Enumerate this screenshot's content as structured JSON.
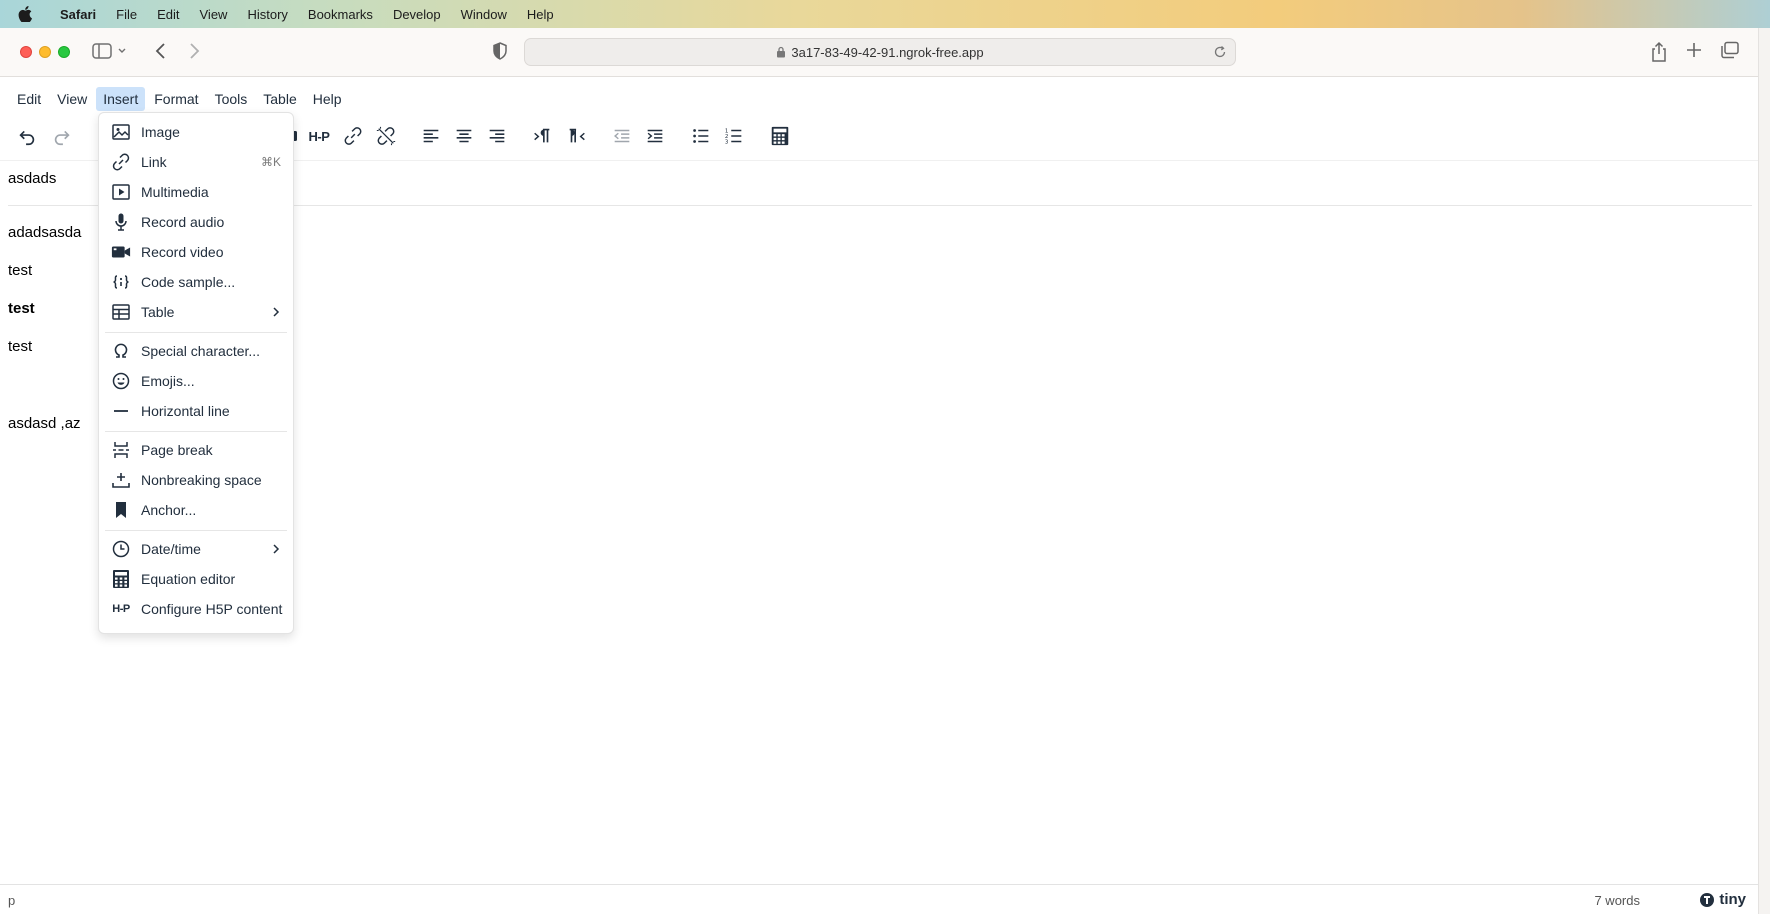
{
  "mac_menu": {
    "app": "Safari",
    "items": [
      "File",
      "Edit",
      "View",
      "History",
      "Bookmarks",
      "Develop",
      "Window",
      "Help"
    ]
  },
  "browser": {
    "url": "3a17-83-49-42-91.ngrok-free.app"
  },
  "editor_menu": {
    "items": [
      "Edit",
      "View",
      "Insert",
      "Format",
      "Tools",
      "Table",
      "Help"
    ]
  },
  "toolbar": {
    "h5p_label": "H-P"
  },
  "insert_menu": {
    "items": [
      {
        "label": "Image",
        "icon": "image-icon"
      },
      {
        "label": "Link",
        "icon": "link-icon",
        "shortcut": "⌘K"
      },
      {
        "label": "Multimedia",
        "icon": "multimedia-icon"
      },
      {
        "label": "Record audio",
        "icon": "microphone-icon"
      },
      {
        "label": "Record video",
        "icon": "video-camera-icon"
      },
      {
        "label": "Code sample...",
        "icon": "code-sample-icon"
      },
      {
        "label": "Table",
        "icon": "table-icon",
        "submenu": true
      },
      {
        "label": "Special character...",
        "icon": "omega-icon"
      },
      {
        "label": "Emojis...",
        "icon": "emoji-icon"
      },
      {
        "label": "Horizontal line",
        "icon": "horizontal-line-icon"
      },
      {
        "label": "Page break",
        "icon": "page-break-icon"
      },
      {
        "label": "Nonbreaking space",
        "icon": "nonbreaking-space-icon"
      },
      {
        "label": "Anchor...",
        "icon": "bookmark-icon"
      },
      {
        "label": "Date/time",
        "icon": "clock-icon",
        "submenu": true
      },
      {
        "label": "Equation editor",
        "icon": "calculator-icon"
      },
      {
        "label": "Configure H5P content",
        "icon": "h5p-icon"
      }
    ]
  },
  "content": {
    "lines": [
      "asdads",
      "adadsasda",
      "test",
      "test",
      "test",
      "asdasd ,az"
    ]
  },
  "status": {
    "path": "p",
    "word_count": "7 words",
    "brand": "tiny"
  }
}
